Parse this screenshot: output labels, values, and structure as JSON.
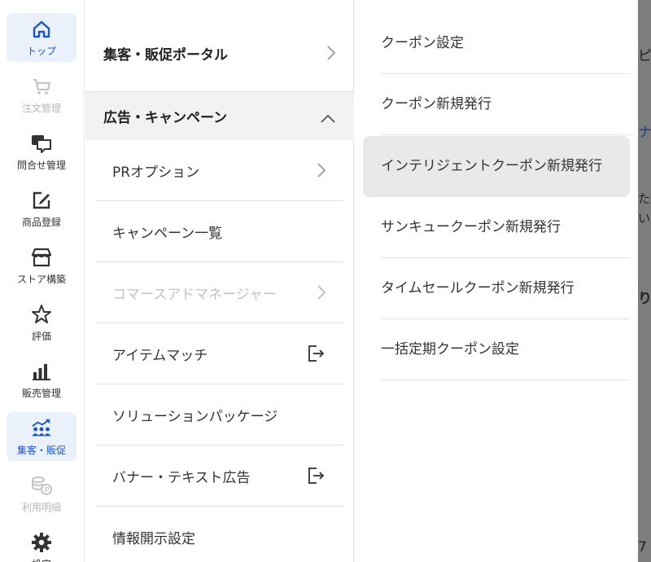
{
  "rail": {
    "items": [
      {
        "label": "トップ",
        "icon": "home-icon"
      },
      {
        "label": "注文管理",
        "icon": "cart-icon"
      },
      {
        "label": "問合せ管理",
        "icon": "chat-icon"
      },
      {
        "label": "商品登録",
        "icon": "edit-icon"
      },
      {
        "label": "ストア構築",
        "icon": "store-icon"
      },
      {
        "label": "評価",
        "icon": "star-icon"
      },
      {
        "label": "販売管理",
        "icon": "bar-chart-icon"
      },
      {
        "label": "集客・販促",
        "icon": "people-growth-icon"
      },
      {
        "label": "利用明細",
        "icon": "coins-icon"
      },
      {
        "label": "設定",
        "icon": "gear-icon"
      }
    ],
    "active_color": "#1a56c8"
  },
  "menu": {
    "portal_label": "集客・販促ポータル",
    "section_label": "広告・キャンペーン",
    "items": [
      {
        "label": "PRオプション"
      },
      {
        "label": "キャンペーン一覧"
      },
      {
        "label": "コマースアドマネージャー"
      },
      {
        "label": "アイテムマッチ"
      },
      {
        "label": "ソリューションパッケージ"
      },
      {
        "label": "バナー・テキスト広告"
      },
      {
        "label": "情報開示設定"
      }
    ]
  },
  "submenu": {
    "items": [
      {
        "label": "クーポン設定"
      },
      {
        "label": "クーポン新規発行"
      },
      {
        "label": "インテリジェントクーポン新規発行"
      },
      {
        "label": "サンキュークーポン新規発行"
      },
      {
        "label": "タイムセールクーポン新規発行"
      },
      {
        "label": "一括定期クーポン設定"
      }
    ]
  },
  "background_page": {
    "fragments": [
      "ピ",
      "ナ",
      "た",
      "い",
      "り",
      "7"
    ]
  }
}
